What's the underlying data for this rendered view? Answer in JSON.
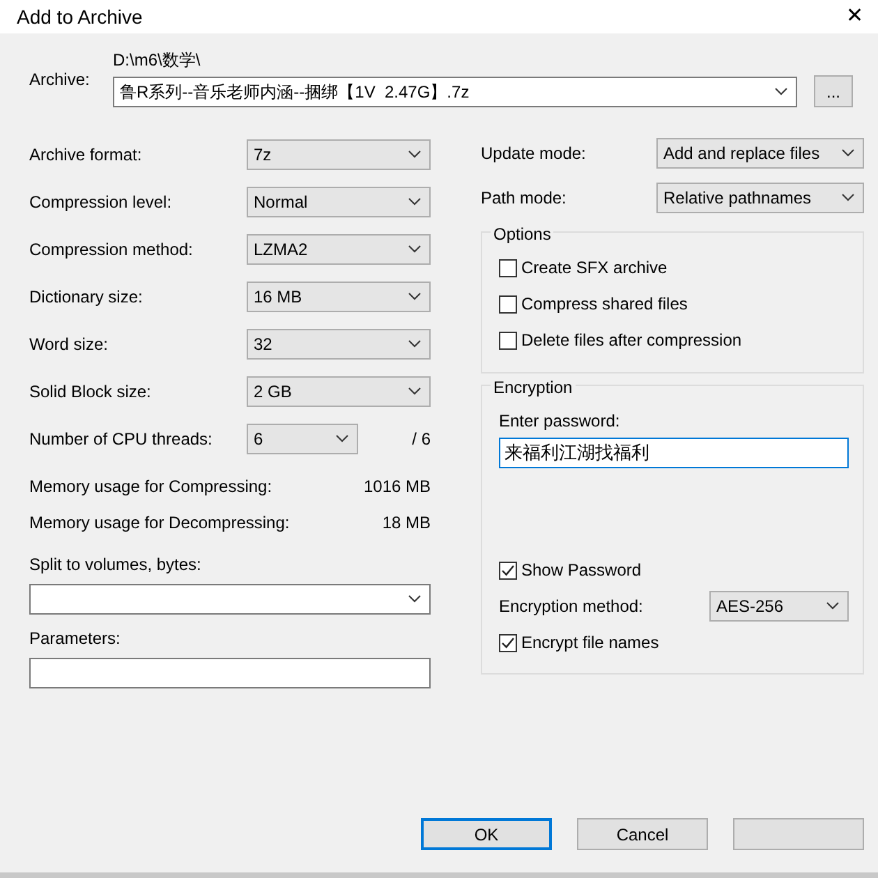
{
  "window": {
    "title": "Add to Archive",
    "close": "✕"
  },
  "archive": {
    "label": "Archive:",
    "folder": "D:\\m6\\数学\\",
    "value": "鲁R系列--音乐老师内涵--捆绑【1V  2.47G】.7z",
    "browse": "..."
  },
  "left_settings": [
    {
      "label": "Archive format:",
      "value": "7z"
    },
    {
      "label": "Compression level:",
      "value": "Normal"
    },
    {
      "label": "Compression method:",
      "value": "LZMA2"
    },
    {
      "label": "Dictionary size:",
      "value": "16 MB"
    },
    {
      "label": "Word size:",
      "value": "32"
    },
    {
      "label": "Solid Block size:",
      "value": "2 GB"
    },
    {
      "label": "Number of CPU threads:",
      "value": "6",
      "suffix": "/ 6"
    }
  ],
  "memory": [
    {
      "label": "Memory usage for Compressing:",
      "value": "1016 MB"
    },
    {
      "label": "Memory usage for Decompressing:",
      "value": "18 MB"
    }
  ],
  "split": {
    "label": "Split to volumes, bytes:"
  },
  "parameters": {
    "label": "Parameters:"
  },
  "right_settings": [
    {
      "label": "Update mode:",
      "value": "Add and replace files"
    },
    {
      "label": "Path mode:",
      "value": "Relative pathnames"
    }
  ],
  "options": {
    "title": "Options",
    "checkboxes": [
      {
        "label": "Create SFX archive",
        "checked": false
      },
      {
        "label": "Compress shared files",
        "checked": false
      },
      {
        "label": "Delete files after compression",
        "checked": false
      }
    ]
  },
  "encryption": {
    "title": "Encryption",
    "password_label": "Enter password:",
    "password": "来福利江湖找福利",
    "show_password": {
      "label": "Show Password",
      "checked": true
    },
    "method_label": "Encryption method:",
    "method": "AES-256",
    "encrypt_names": {
      "label": "Encrypt file names",
      "checked": true
    }
  },
  "buttons": [
    {
      "label": "OK",
      "default": true
    },
    {
      "label": "Cancel",
      "default": false
    },
    {
      "default": false
    }
  ]
}
